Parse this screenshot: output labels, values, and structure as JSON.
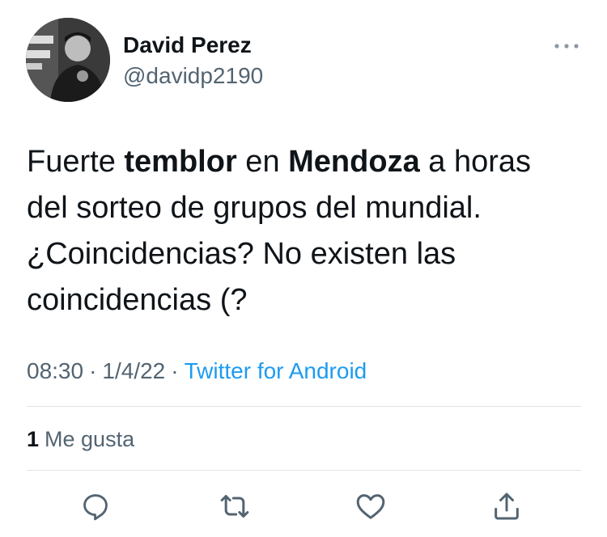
{
  "author": {
    "name": "David Perez",
    "handle": "@davidp2190"
  },
  "tweet": {
    "lines": [
      [
        "Fuerte ",
        "temblor",
        " en ",
        "Mendoza",
        " a horas"
      ],
      [
        "del sorteo de grupos del mundial."
      ],
      [
        "¿Coincidencias? No existen las"
      ],
      [
        "coincidencias (?"
      ]
    ],
    "bold_words": [
      "temblor",
      "Mendoza"
    ]
  },
  "meta": {
    "time": "08:30",
    "separator": "·",
    "date": "1/4/22",
    "source": "Twitter for Android"
  },
  "engagement": {
    "likes_count": "1",
    "likes_label": "Me gusta"
  },
  "actions": [
    {
      "name": "reply",
      "icon": "reply-icon"
    },
    {
      "name": "retweet",
      "icon": "retweet-icon"
    },
    {
      "name": "like",
      "icon": "heart-icon"
    },
    {
      "name": "share",
      "icon": "share-icon"
    }
  ],
  "colors": {
    "text": "#0f1419",
    "secondary": "#536471",
    "link": "#1d9bf0",
    "divider": "#e1e5e8"
  }
}
